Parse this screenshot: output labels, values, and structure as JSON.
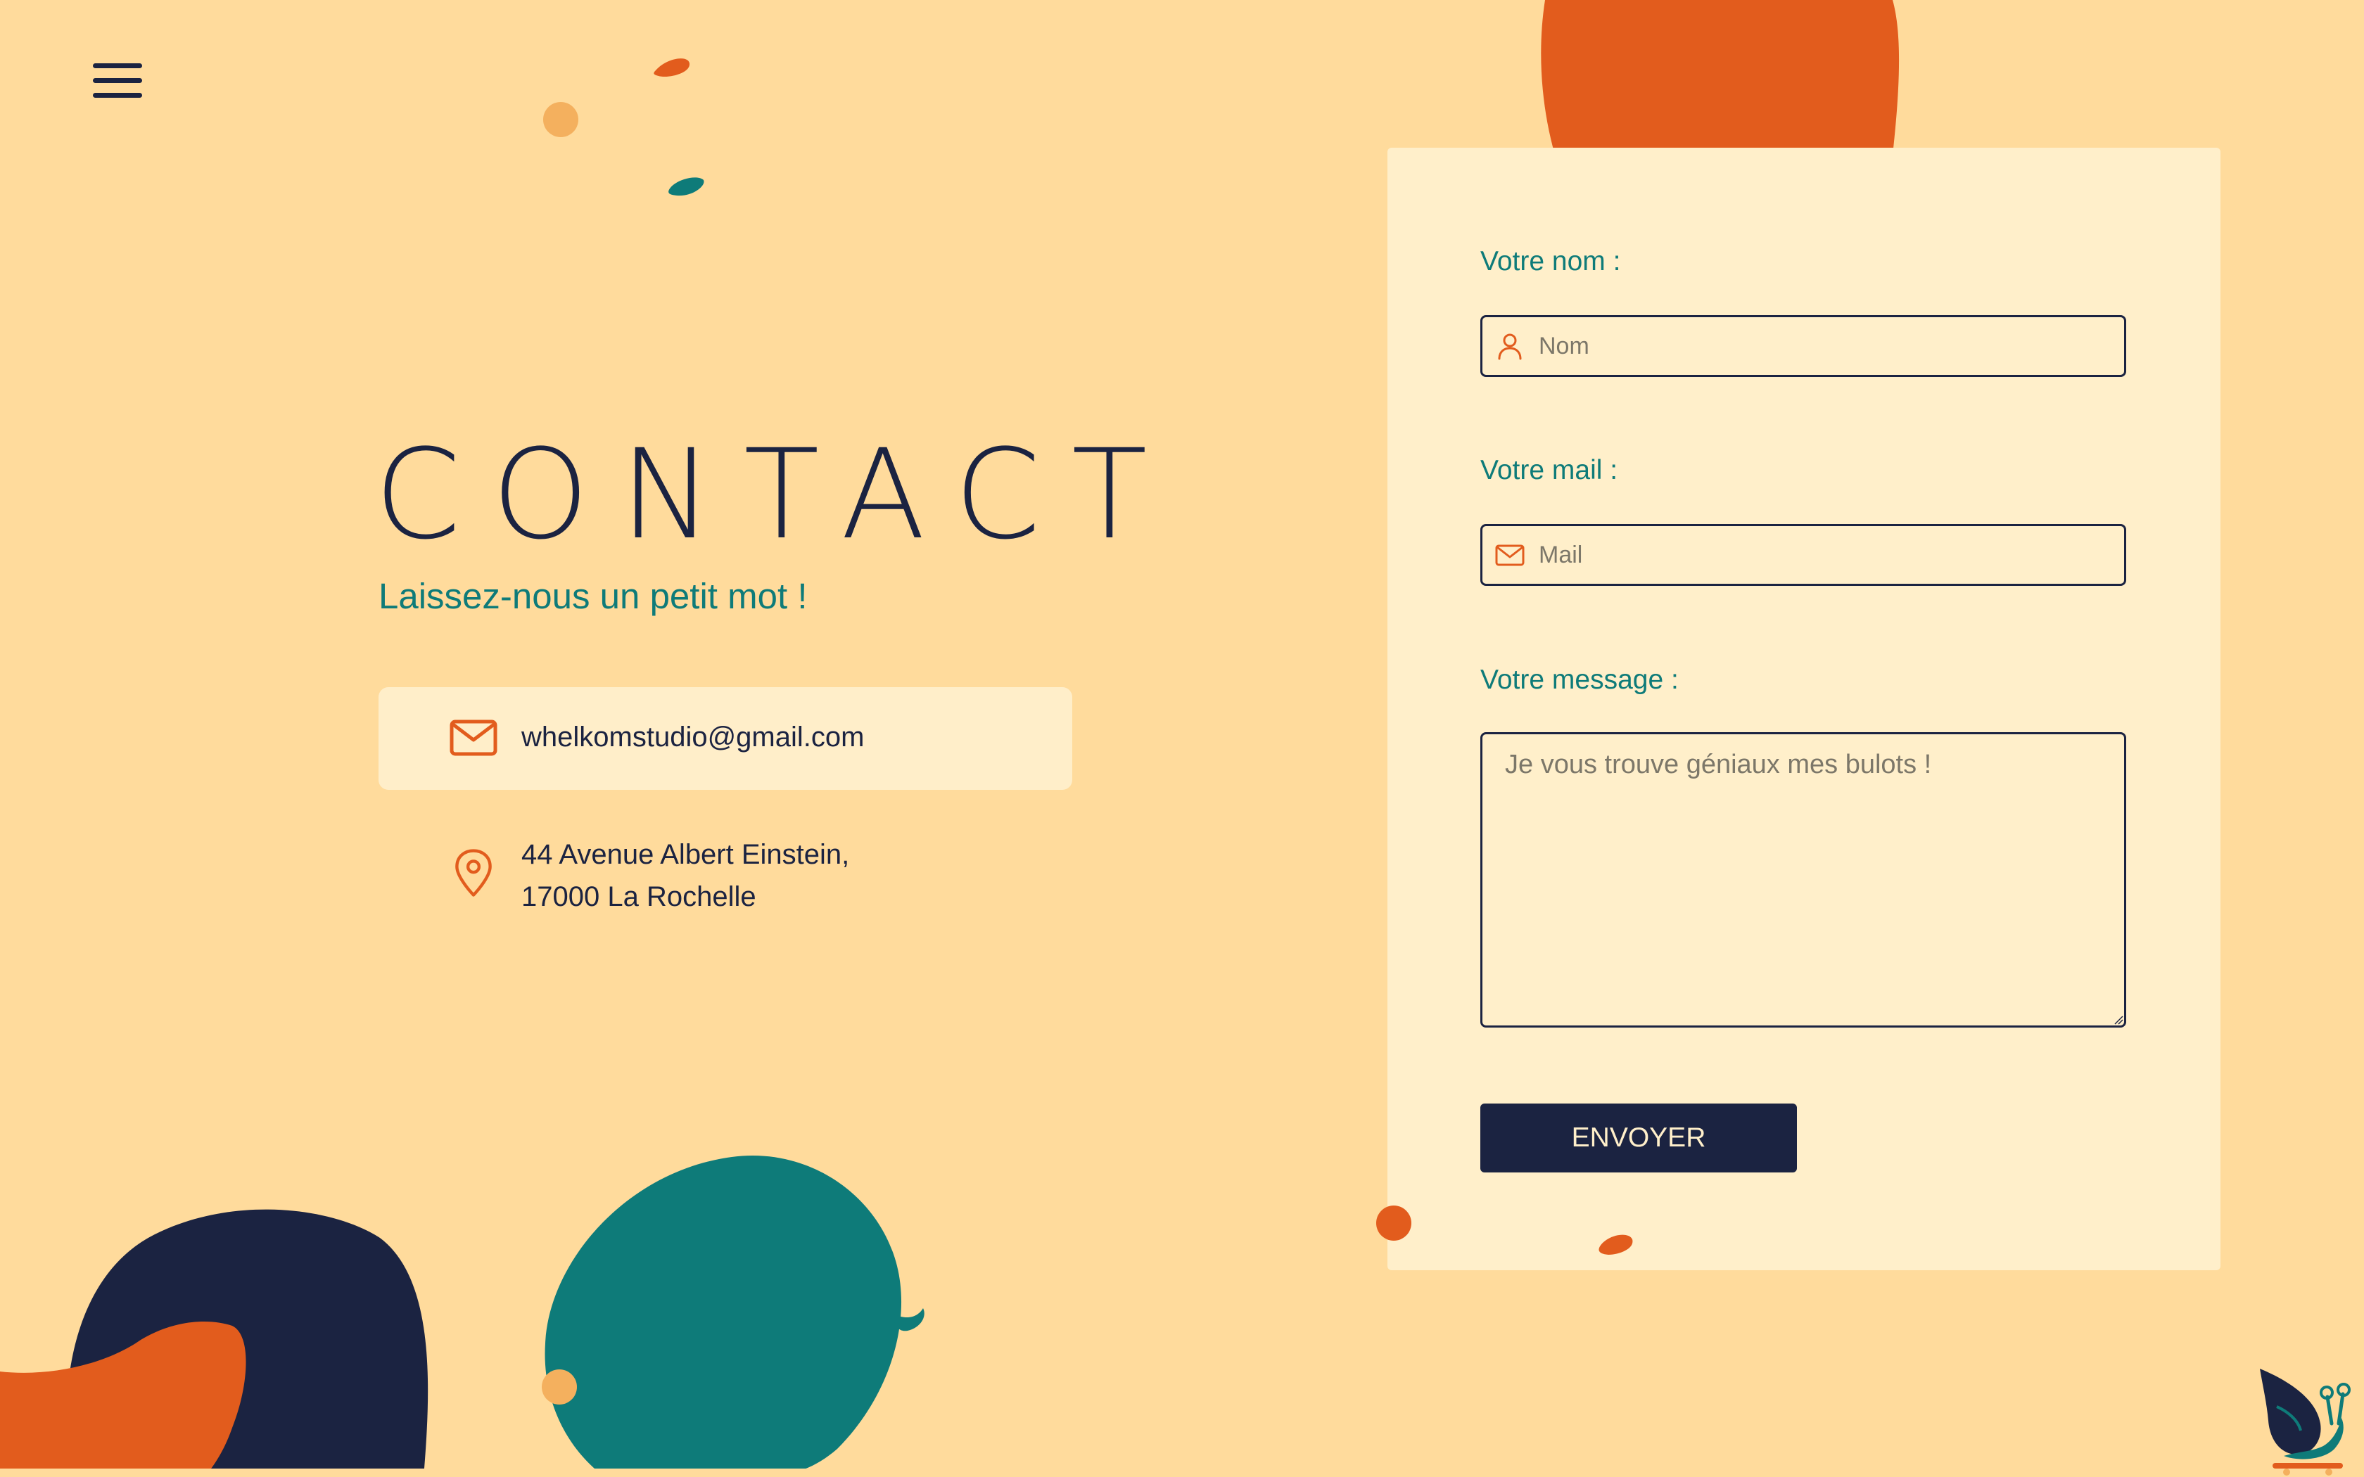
{
  "header": {
    "menu_icon": "hamburger-menu-icon"
  },
  "contact": {
    "title": "CONTACT",
    "subtitle": "Laissez-nous un petit mot !",
    "email": "whelkomstudio@gmail.com",
    "email_icon": "mail-icon",
    "address_line1": "44 Avenue Albert Einstein,",
    "address_line2": "17000 La Rochelle",
    "address_icon": "location-pin-icon"
  },
  "form": {
    "name_label": "Votre nom :",
    "name_placeholder": "Nom",
    "name_icon": "user-icon",
    "mail_label": "Votre mail :",
    "mail_placeholder": "Mail",
    "mail_icon": "mail-icon",
    "message_label": "Votre message :",
    "message_placeholder": "Je vous trouve géniaux mes bulots !",
    "submit_label": "ENVOYER"
  },
  "colors": {
    "background": "#FFDB9C",
    "card": "#FFEFCA",
    "navy": "#1B2341",
    "teal": "#0E7B79",
    "orange": "#E25C1D",
    "light_orange": "#F4B05E"
  },
  "mascot": "snail-skateboard-mascot"
}
